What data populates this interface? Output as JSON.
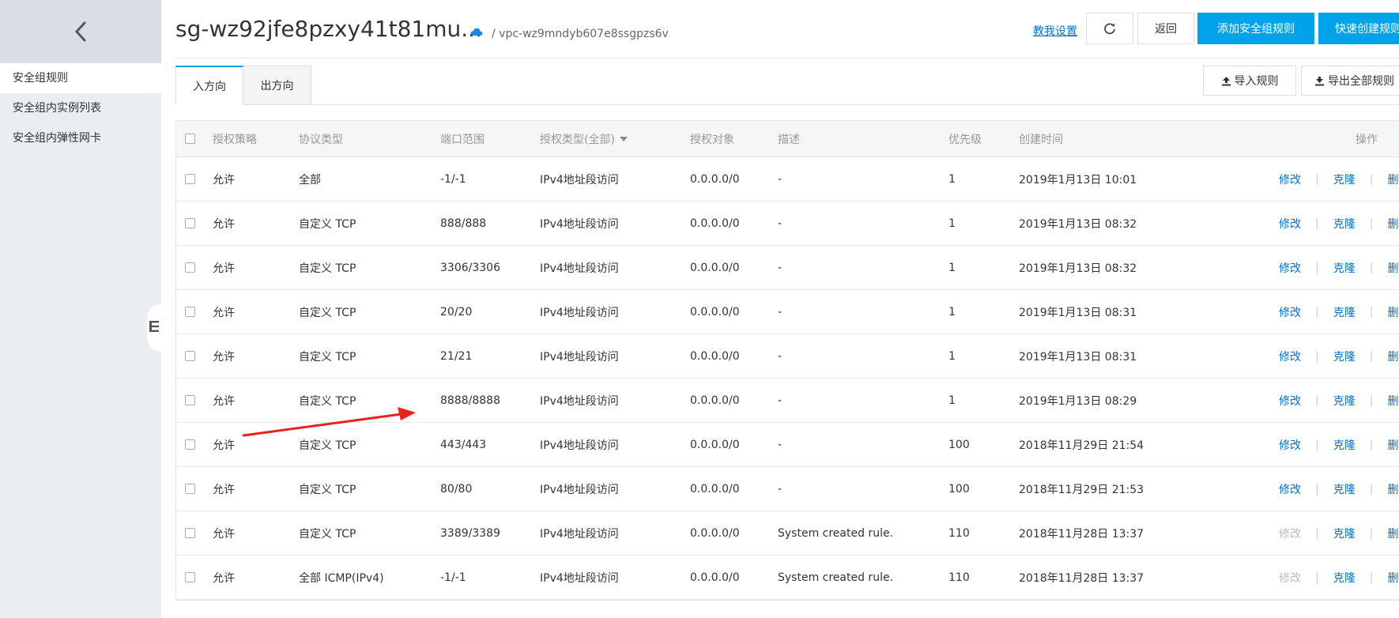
{
  "sidebar": {
    "items": [
      {
        "label": "安全组规则",
        "active": true
      },
      {
        "label": "安全组内实例列表",
        "active": false
      },
      {
        "label": "安全组内弹性网卡",
        "active": false
      }
    ]
  },
  "header": {
    "title": "sg-wz92jfe8pzxy41t81mu...",
    "vpc_path": "/ vpc-wz9mndyb607e8ssgpzs6v",
    "help_link": "教我设置",
    "back_label": "返回",
    "add_rule_label": "添加安全组规则",
    "quick_create_label": "快速创建规则"
  },
  "tabs": [
    {
      "label": "入方向",
      "active": true
    },
    {
      "label": "出方向",
      "active": false
    }
  ],
  "actions": {
    "import_label": "导入规则",
    "export_label": "导出全部规则"
  },
  "table": {
    "columns": [
      "授权策略",
      "协议类型",
      "端口范围",
      "授权类型(全部)",
      "授权对象",
      "描述",
      "优先级",
      "创建时间",
      "操作"
    ],
    "op_labels": {
      "edit": "修改",
      "clone": "克隆",
      "delete": "删除"
    },
    "rows": [
      {
        "policy": "允许",
        "protocol": "全部",
        "port": "-1/-1",
        "auth_type": "IPv4地址段访问",
        "target": "0.0.0.0/0",
        "desc": "-",
        "priority": "1",
        "created": "2019年1月13日 10:01",
        "edit_enabled": true
      },
      {
        "policy": "允许",
        "protocol": "自定义 TCP",
        "port": "888/888",
        "auth_type": "IPv4地址段访问",
        "target": "0.0.0.0/0",
        "desc": "-",
        "priority": "1",
        "created": "2019年1月13日 08:32",
        "edit_enabled": true
      },
      {
        "policy": "允许",
        "protocol": "自定义 TCP",
        "port": "3306/3306",
        "auth_type": "IPv4地址段访问",
        "target": "0.0.0.0/0",
        "desc": "-",
        "priority": "1",
        "created": "2019年1月13日 08:32",
        "edit_enabled": true
      },
      {
        "policy": "允许",
        "protocol": "自定义 TCP",
        "port": "20/20",
        "auth_type": "IPv4地址段访问",
        "target": "0.0.0.0/0",
        "desc": "-",
        "priority": "1",
        "created": "2019年1月13日 08:31",
        "edit_enabled": true
      },
      {
        "policy": "允许",
        "protocol": "自定义 TCP",
        "port": "21/21",
        "auth_type": "IPv4地址段访问",
        "target": "0.0.0.0/0",
        "desc": "-",
        "priority": "1",
        "created": "2019年1月13日 08:31",
        "edit_enabled": true
      },
      {
        "policy": "允许",
        "protocol": "自定义 TCP",
        "port": "8888/8888",
        "auth_type": "IPv4地址段访问",
        "target": "0.0.0.0/0",
        "desc": "-",
        "priority": "1",
        "created": "2019年1月13日 08:29",
        "edit_enabled": true
      },
      {
        "policy": "允许",
        "protocol": "自定义 TCP",
        "port": "443/443",
        "auth_type": "IPv4地址段访问",
        "target": "0.0.0.0/0",
        "desc": "-",
        "priority": "100",
        "created": "2018年11月29日 21:54",
        "edit_enabled": true
      },
      {
        "policy": "允许",
        "protocol": "自定义 TCP",
        "port": "80/80",
        "auth_type": "IPv4地址段访问",
        "target": "0.0.0.0/0",
        "desc": "-",
        "priority": "100",
        "created": "2018年11月29日 21:53",
        "edit_enabled": true
      },
      {
        "policy": "允许",
        "protocol": "自定义 TCP",
        "port": "3389/3389",
        "auth_type": "IPv4地址段访问",
        "target": "0.0.0.0/0",
        "desc": "System created rule.",
        "priority": "110",
        "created": "2018年11月28日 13:37",
        "edit_enabled": false
      },
      {
        "policy": "允许",
        "protocol": "全部 ICMP(IPv4)",
        "port": "-1/-1",
        "auth_type": "IPv4地址段访问",
        "target": "0.0.0.0/0",
        "desc": "System created rule.",
        "priority": "110",
        "created": "2018年11月28日 13:37",
        "edit_enabled": false
      }
    ]
  },
  "colors": {
    "primary": "#00a2ea",
    "link": "#0070cc",
    "annotation_arrow": "#e8231c"
  }
}
